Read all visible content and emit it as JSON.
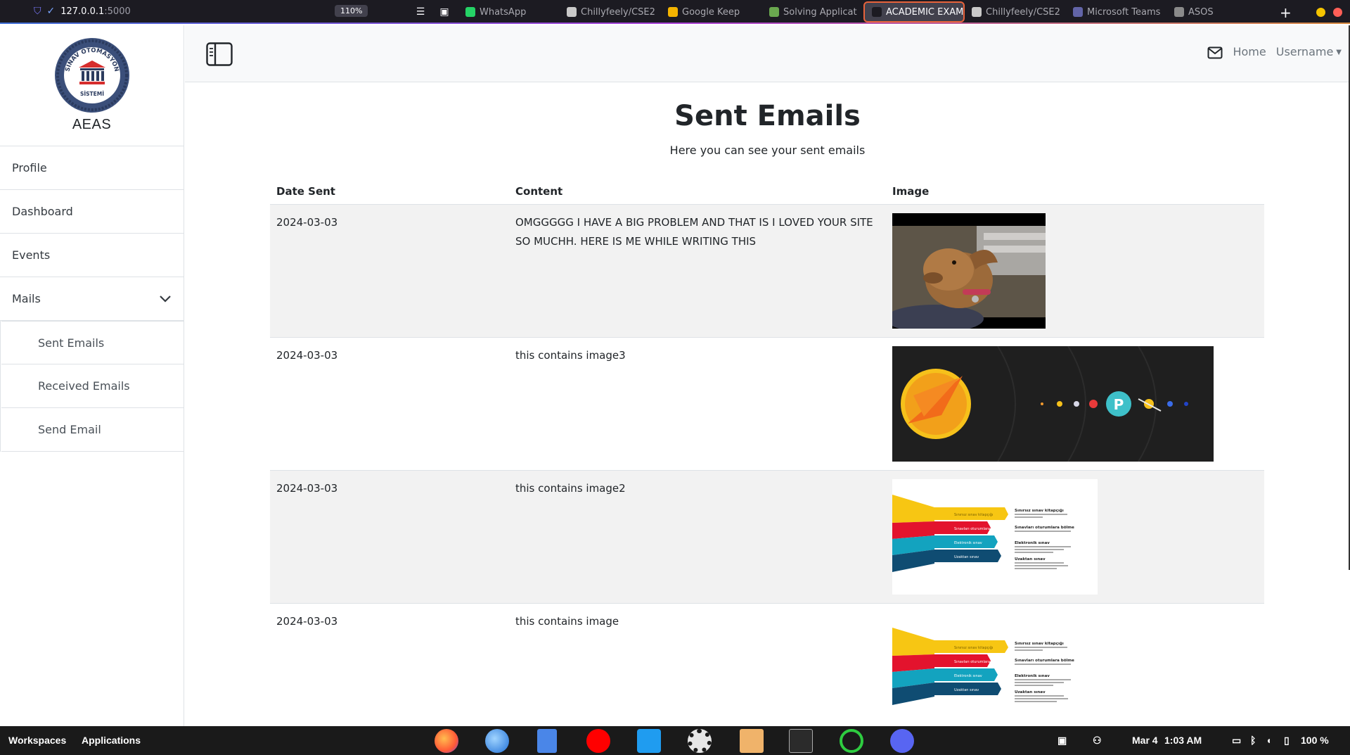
{
  "browser": {
    "url_host": "127.0.0.1",
    "url_port": ":5000",
    "zoom": "110%",
    "tabs": [
      {
        "label": "WhatsApp",
        "color": "#25d366"
      },
      {
        "label": "Chillyfeely/CSE2",
        "color": "#c9c9c9"
      },
      {
        "label": "Google Keep",
        "color": "#f4b400"
      },
      {
        "label": "Solving Applicat",
        "color": "#6aa84f"
      },
      {
        "label": "ACADEMIC EXAM",
        "color": "#1c1b22"
      },
      {
        "label": "Chillyfeely/CSE2",
        "color": "#c9c9c9"
      },
      {
        "label": "Microsoft Teams",
        "color": "#6264a7"
      },
      {
        "label": "ASOS",
        "color": "#8a8a8a"
      }
    ],
    "accent_color": "#e8633b"
  },
  "sidebar": {
    "logo_top_text": "SINAV OTOMASYON",
    "logo_bottom_text": "SİSTEMİ",
    "brand": "AEAS",
    "items": [
      {
        "label": "Profile"
      },
      {
        "label": "Dashboard"
      },
      {
        "label": "Events"
      },
      {
        "label": "Mails",
        "icon": "chevron-down-icon"
      }
    ],
    "sub_items": [
      {
        "label": "Sent Emails"
      },
      {
        "label": "Received Emails"
      },
      {
        "label": "Send Email"
      }
    ]
  },
  "header": {
    "home": "Home",
    "username": "Username",
    "icons": [
      "sidebar-toggle-icon",
      "mail-icon",
      "caret-down-icon"
    ]
  },
  "main": {
    "title": "Sent Emails",
    "subtitle": "Here you can see your sent emails",
    "columns": [
      "Date Sent",
      "Content",
      "Image"
    ],
    "rows": [
      {
        "date": "2024-03-03",
        "content": "OMGGGGG I HAVE A BIG PROBLEM AND THAT IS I LOVED YOUR SITE SO MUCHH. HERE IS ME WHILE WRITING THIS",
        "image": "dog-photo"
      },
      {
        "date": "2024-03-03",
        "content": "this contains image3",
        "image": "planets-illustration"
      },
      {
        "date": "2024-03-03",
        "content": "this contains image2",
        "image": "exam-infographic"
      },
      {
        "date": "2024-03-03",
        "content": "this contains image",
        "image": "exam-infographic"
      }
    ],
    "infographic": {
      "bar_labels": [
        "Sınırsız sınav kitapçığı",
        "Sınavları oturumlara bölme",
        "Elektronik sınav",
        "Uzaktan sınav"
      ],
      "bar_colors": [
        "#f7c613",
        "#e3132d",
        "#13a3bf",
        "#0f4c72"
      ],
      "item_titles": [
        "Sınırsız sınav kitapçığı",
        "Sınavları oturumlara bölme",
        "Elektronik sınav",
        "Uzaktan sınav"
      ]
    }
  },
  "taskbar": {
    "workspaces": "Workspaces",
    "applications": "Applications",
    "apps": [
      "firefox-icon",
      "thunderbird-icon",
      "files-icon",
      "youtube-music-icon",
      "vscode-icon",
      "settings-icon",
      "package-icon",
      "terminal-icon",
      "loading-icon",
      "discord-icon"
    ],
    "date": "Mar 4",
    "time": "1:03 AM",
    "battery": "100 %"
  }
}
